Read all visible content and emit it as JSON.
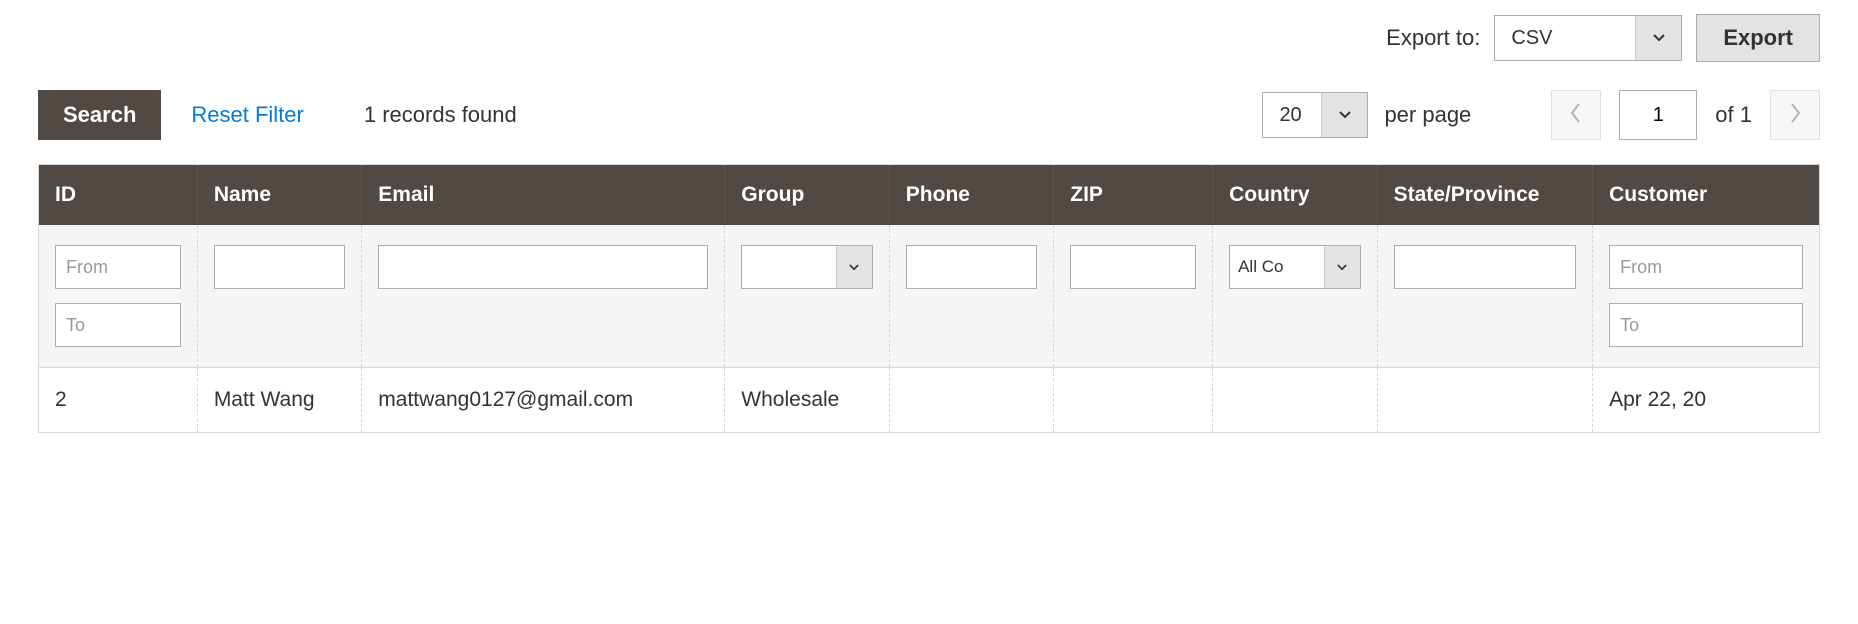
{
  "export": {
    "label": "Export to:",
    "format": "CSV",
    "button": "Export"
  },
  "toolbar": {
    "search": "Search",
    "reset": "Reset Filter",
    "records_found": "1 records found",
    "per_page_value": "20",
    "per_page_label": "per page",
    "page_current": "1",
    "page_of": "of 1"
  },
  "columns": {
    "id": "ID",
    "name": "Name",
    "email": "Email",
    "group": "Group",
    "phone": "Phone",
    "zip": "ZIP",
    "country": "Country",
    "state": "State/Province",
    "customer": "Customer"
  },
  "filters": {
    "id_from_ph": "From",
    "id_to_ph": "To",
    "name": "",
    "email": "",
    "group": "",
    "phone": "",
    "zip": "",
    "country": "All Co",
    "state": "",
    "cust_from_ph": "From",
    "cust_to_ph": "To"
  },
  "rows": [
    {
      "id": "2",
      "name": "Matt Wang",
      "email": "mattwang0127@gmail.com",
      "group": "Wholesale",
      "phone": "",
      "zip": "",
      "country": "",
      "state": "",
      "customer": "Apr 22, 20"
    }
  ]
}
